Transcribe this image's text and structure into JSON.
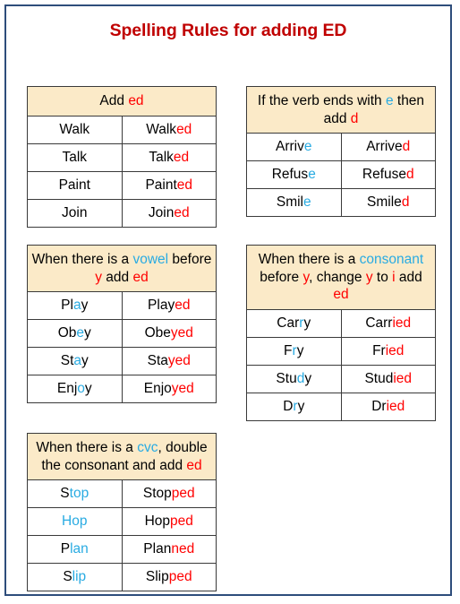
{
  "page": {
    "title": "Spelling Rules for adding ED",
    "title_color": "#c00000",
    "border_color": "#2e4d7b",
    "header_bg": "#fbeac8",
    "accent_red": "#ff0000",
    "accent_blue": "#29abe2"
  },
  "tables": [
    {
      "id": "table-add-ed",
      "header_plain": "Add ed",
      "header_parts": [
        {
          "text": "Add ",
          "color": "black"
        },
        {
          "text": "ed",
          "color": "red"
        }
      ],
      "rows": [
        {
          "base_plain": "Walk",
          "base_parts": [
            {
              "text": "Walk",
              "color": "black"
            }
          ],
          "past_plain": "Walked",
          "past_parts": [
            {
              "text": "Walk",
              "color": "black"
            },
            {
              "text": "ed",
              "color": "red"
            }
          ]
        },
        {
          "base_plain": "Talk",
          "base_parts": [
            {
              "text": "Talk",
              "color": "black"
            }
          ],
          "past_plain": "Talked",
          "past_parts": [
            {
              "text": "Talk",
              "color": "black"
            },
            {
              "text": "ed",
              "color": "red"
            }
          ]
        },
        {
          "base_plain": "Paint",
          "base_parts": [
            {
              "text": "Paint",
              "color": "black"
            }
          ],
          "past_plain": "Painted",
          "past_parts": [
            {
              "text": "Paint",
              "color": "black"
            },
            {
              "text": "ed",
              "color": "red"
            }
          ]
        },
        {
          "base_plain": "Join",
          "base_parts": [
            {
              "text": "Join",
              "color": "black"
            }
          ],
          "past_plain": "Joined",
          "past_parts": [
            {
              "text": "Join",
              "color": "black"
            },
            {
              "text": "ed",
              "color": "red"
            }
          ]
        }
      ]
    },
    {
      "id": "table-verb-ends-e",
      "header_plain": "If the verb ends with e then add d",
      "header_parts": [
        {
          "text": "If the verb ends with ",
          "color": "black"
        },
        {
          "text": "e",
          "color": "blue"
        },
        {
          "text": " then add ",
          "color": "black"
        },
        {
          "text": "d",
          "color": "red"
        }
      ],
      "rows": [
        {
          "base_plain": "Arrive",
          "base_parts": [
            {
              "text": "Arriv",
              "color": "black"
            },
            {
              "text": "e",
              "color": "blue"
            }
          ],
          "past_plain": "Arrived",
          "past_parts": [
            {
              "text": "Arrive",
              "color": "black"
            },
            {
              "text": "d",
              "color": "red"
            }
          ]
        },
        {
          "base_plain": "Refuse",
          "base_parts": [
            {
              "text": "Refus",
              "color": "black"
            },
            {
              "text": "e",
              "color": "blue"
            }
          ],
          "past_plain": "Refused",
          "past_parts": [
            {
              "text": "Refuse",
              "color": "black"
            },
            {
              "text": "d",
              "color": "red"
            }
          ]
        },
        {
          "base_plain": "Smile",
          "base_parts": [
            {
              "text": "Smil",
              "color": "black"
            },
            {
              "text": "e",
              "color": "blue"
            }
          ],
          "past_plain": "Smiled",
          "past_parts": [
            {
              "text": "Smile",
              "color": "black"
            },
            {
              "text": "d",
              "color": "red"
            }
          ]
        }
      ]
    },
    {
      "id": "table-vowel-before-y",
      "header_plain": "When there is a vowel before y add ed",
      "header_parts": [
        {
          "text": "When there is a ",
          "color": "black"
        },
        {
          "text": "vowel",
          "color": "blue"
        },
        {
          "text": " before ",
          "color": "black"
        },
        {
          "text": "y",
          "color": "red"
        },
        {
          "text": " add ",
          "color": "black"
        },
        {
          "text": "ed",
          "color": "red"
        }
      ],
      "rows": [
        {
          "base_plain": "Play",
          "base_parts": [
            {
              "text": "Pl",
              "color": "black"
            },
            {
              "text": "a",
              "color": "blue"
            },
            {
              "text": "y",
              "color": "black"
            }
          ],
          "past_plain": "Played",
          "past_parts": [
            {
              "text": "Play",
              "color": "black"
            },
            {
              "text": "ed",
              "color": "red"
            }
          ]
        },
        {
          "base_plain": "Obey",
          "base_parts": [
            {
              "text": "Ob",
              "color": "black"
            },
            {
              "text": "e",
              "color": "blue"
            },
            {
              "text": "y",
              "color": "black"
            }
          ],
          "past_plain": "Obeyed",
          "past_parts": [
            {
              "text": "Obe",
              "color": "black"
            },
            {
              "text": "yed",
              "color": "red"
            }
          ]
        },
        {
          "base_plain": "Stay",
          "base_parts": [
            {
              "text": "St",
              "color": "black"
            },
            {
              "text": "a",
              "color": "blue"
            },
            {
              "text": "y",
              "color": "black"
            }
          ],
          "past_plain": "Stayed",
          "past_parts": [
            {
              "text": "Sta",
              "color": "black"
            },
            {
              "text": "yed",
              "color": "red"
            }
          ]
        },
        {
          "base_plain": "Enjoy",
          "base_parts": [
            {
              "text": "Enj",
              "color": "black"
            },
            {
              "text": "o",
              "color": "blue"
            },
            {
              "text": "y",
              "color": "black"
            }
          ],
          "past_plain": "Enjoyed",
          "past_parts": [
            {
              "text": "Enjo",
              "color": "black"
            },
            {
              "text": "yed",
              "color": "red"
            }
          ]
        }
      ]
    },
    {
      "id": "table-consonant-y",
      "header_plain": "When there is a consonant before y, change y to i add ed",
      "header_parts": [
        {
          "text": "When there is a ",
          "color": "black"
        },
        {
          "text": "consonant",
          "color": "blue"
        },
        {
          "text": " before ",
          "color": "black"
        },
        {
          "text": "y",
          "color": "red"
        },
        {
          "text": ", change ",
          "color": "black"
        },
        {
          "text": "y",
          "color": "red"
        },
        {
          "text": " to ",
          "color": "black"
        },
        {
          "text": "i",
          "color": "red"
        },
        {
          "text": " add ",
          "color": "black"
        },
        {
          "text": "ed",
          "color": "red"
        }
      ],
      "rows": [
        {
          "base_plain": "Carry",
          "base_parts": [
            {
              "text": "Car",
              "color": "black"
            },
            {
              "text": "r",
              "color": "blue"
            },
            {
              "text": "y",
              "color": "black"
            }
          ],
          "past_plain": "Carried",
          "past_parts": [
            {
              "text": "Carr",
              "color": "black"
            },
            {
              "text": "ied",
              "color": "red"
            }
          ]
        },
        {
          "base_plain": "Fry",
          "base_parts": [
            {
              "text": "F",
              "color": "black"
            },
            {
              "text": "r",
              "color": "blue"
            },
            {
              "text": "y",
              "color": "black"
            }
          ],
          "past_plain": "Fried",
          "past_parts": [
            {
              "text": "Fr",
              "color": "black"
            },
            {
              "text": "ied",
              "color": "red"
            }
          ]
        },
        {
          "base_plain": "Study",
          "base_parts": [
            {
              "text": "Stu",
              "color": "black"
            },
            {
              "text": "d",
              "color": "blue"
            },
            {
              "text": "y",
              "color": "black"
            }
          ],
          "past_plain": "Studied",
          "past_parts": [
            {
              "text": "Stud",
              "color": "black"
            },
            {
              "text": "ied",
              "color": "red"
            }
          ]
        },
        {
          "base_plain": "Dry",
          "base_parts": [
            {
              "text": "D",
              "color": "black"
            },
            {
              "text": "r",
              "color": "blue"
            },
            {
              "text": "y",
              "color": "black"
            }
          ],
          "past_plain": "Dried",
          "past_parts": [
            {
              "text": "Dr",
              "color": "black"
            },
            {
              "text": "ied",
              "color": "red"
            }
          ]
        }
      ]
    },
    {
      "id": "table-cvc-double",
      "header_plain": "When there is a cvc, double the consonant and add ed",
      "header_parts": [
        {
          "text": "When there is a ",
          "color": "black"
        },
        {
          "text": "cvc",
          "color": "blue"
        },
        {
          "text": ", double the consonant and add ",
          "color": "black"
        },
        {
          "text": "ed",
          "color": "red"
        }
      ],
      "rows": [
        {
          "base_plain": "Stop",
          "base_parts": [
            {
              "text": "S",
              "color": "black"
            },
            {
              "text": "top",
              "color": "blue"
            }
          ],
          "past_plain": "Stopped",
          "past_parts": [
            {
              "text": "Stop",
              "color": "black"
            },
            {
              "text": "ped",
              "color": "red"
            }
          ]
        },
        {
          "base_plain": "Hop",
          "base_parts": [
            {
              "text": "Hop",
              "color": "blue"
            }
          ],
          "past_plain": "Hopped",
          "past_parts": [
            {
              "text": "Hop",
              "color": "black"
            },
            {
              "text": "ped",
              "color": "red"
            }
          ]
        },
        {
          "base_plain": "Plan",
          "base_parts": [
            {
              "text": "P",
              "color": "black"
            },
            {
              "text": "lan",
              "color": "blue"
            }
          ],
          "past_plain": "Planned",
          "past_parts": [
            {
              "text": "Plan",
              "color": "black"
            },
            {
              "text": "ned",
              "color": "red"
            }
          ]
        },
        {
          "base_plain": "Slip",
          "base_parts": [
            {
              "text": "S",
              "color": "black"
            },
            {
              "text": "lip",
              "color": "blue"
            }
          ],
          "past_plain": "Slipped",
          "past_parts": [
            {
              "text": "Slip",
              "color": "black"
            },
            {
              "text": "ped",
              "color": "red"
            }
          ]
        }
      ]
    }
  ]
}
